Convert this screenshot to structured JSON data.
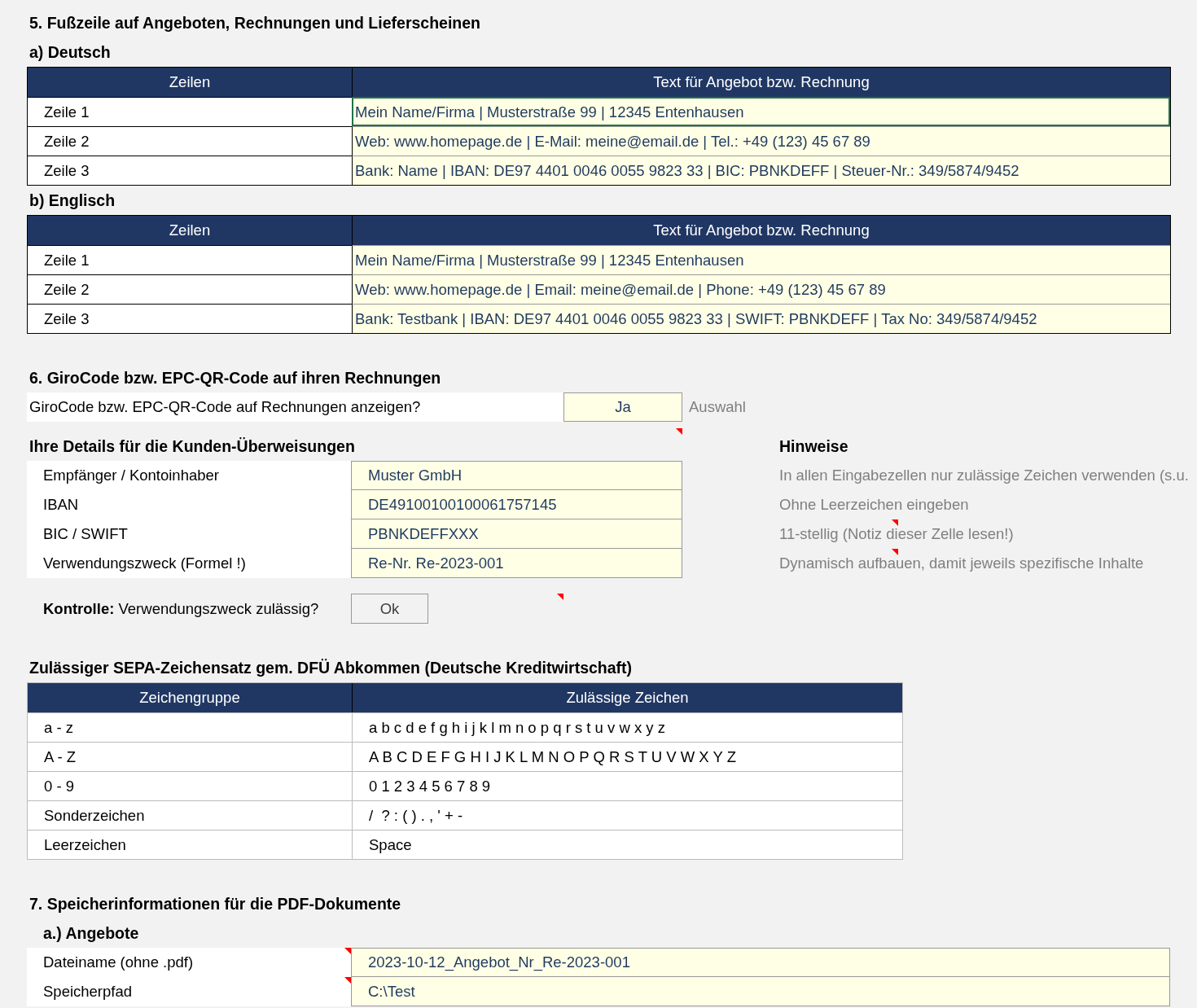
{
  "footer_section": {
    "title": "5. Fußzeile auf Angeboten, Rechnungen und Lieferscheinen",
    "tables": [
      {
        "title": "a) Deutsch",
        "columns": [
          "Zeilen",
          "Text für Angebot bzw. Rechnung"
        ],
        "rows": [
          {
            "label": "Zeile 1",
            "text": "Mein Name/Firma | Musterstraße 99 | 12345 Entenhausen",
            "selected": true
          },
          {
            "label": "Zeile 2",
            "text": "Web: www.homepage.de | E-Mail: meine@email.de | Tel.: +49 (123) 45 67 89",
            "selected": false
          },
          {
            "label": "Zeile 3",
            "text": "Bank: Name | IBAN: DE97 4401 0046 0055 9823 33 | BIC: PBNKDEFF | Steuer-Nr.: 349/5874/9452",
            "selected": false
          }
        ]
      },
      {
        "title": "b) Englisch",
        "columns": [
          "Zeilen",
          "Text für Angebot bzw. Rechnung"
        ],
        "rows": [
          {
            "label": "Zeile 1",
            "text": "Mein Name/Firma | Musterstraße 99 | 12345 Entenhausen",
            "selected": false
          },
          {
            "label": "Zeile 2",
            "text": "Web: www.homepage.de | Email: meine@email.de | Phone: +49 (123) 45 67 89",
            "selected": false
          },
          {
            "label": "Zeile 3",
            "text": "Bank: Testbank | IBAN: DE97 4401 0046 0055 9823 33 | SWIFT: PBNKDEFF | Tax No: 349/5874/9452",
            "selected": false
          }
        ]
      }
    ]
  },
  "girocode": {
    "title": "6. GiroCode bzw. EPC-QR-Code auf ihren Rechnungen",
    "question": "GiroCode bzw. EPC-QR-Code auf Rechnungen anzeigen?",
    "answer": "Ja",
    "answer_hint": "Auswahl",
    "details_title": "Ihre Details für die Kunden-Überweisungen",
    "details_note": true,
    "hints_title": "Hinweise",
    "fields": [
      {
        "label": "Empfänger / Kontoinhaber",
        "value": "Muster GmbH",
        "hint": "In allen Eingabezellen nur zulässige Zeichen verwenden (s.u.",
        "hint_note": false
      },
      {
        "label": "IBAN",
        "value": "DE49100100100061757145",
        "hint": "Ohne Leerzeichen eingeben",
        "hint_note": false
      },
      {
        "label": "BIC / SWIFT",
        "value": "PBNKDEFFXXX",
        "hint": "11-stellig (Notiz dieser Zelle lesen!)",
        "hint_note": true
      },
      {
        "label": "Verwendungszweck (Formel !)",
        "value": "Re-Nr. Re-2023-001",
        "hint": "Dynamisch aufbauen, damit jeweils spezifische Inhalte",
        "hint_note": true
      }
    ],
    "check_label": "**Kontrolle:** Verwendungszweck zulässig?",
    "check_result": "Ok",
    "check_note": true
  },
  "charset": {
    "title": "Zulässiger SEPA-Zeichensatz gem. DFÜ Abkommen (Deutsche Kreditwirtschaft)",
    "columns": [
      "Zeichengruppe",
      "Zulässige Zeichen"
    ],
    "rows": [
      {
        "group": "a - z",
        "chars": "a b c d e f g h i j k l m n o p q r s t u v w x y z"
      },
      {
        "group": "A - Z",
        "chars": "A B C D E F G H I J K L M N O P Q R S T U V W X Y Z"
      },
      {
        "group": "0 - 9",
        "chars": "0 1 2 3 4 5 6 7 8 9"
      },
      {
        "group": "Sonderzeichen",
        "chars": "/  ? : ( ) . , ' + -"
      },
      {
        "group": "Leerzeichen",
        "chars": "Space"
      }
    ]
  },
  "storage": {
    "title": "7. Speicherinformationen für die PDF-Dokumente",
    "subtitle": "a.) Angebote",
    "fields": [
      {
        "label": "Dateiname (ohne .pdf)",
        "value": "2023-10-12_Angebot_Nr_Re-2023-001",
        "note": true
      },
      {
        "label": "Speicherpfad",
        "value": "C:\\Test",
        "note": true
      }
    ]
  }
}
